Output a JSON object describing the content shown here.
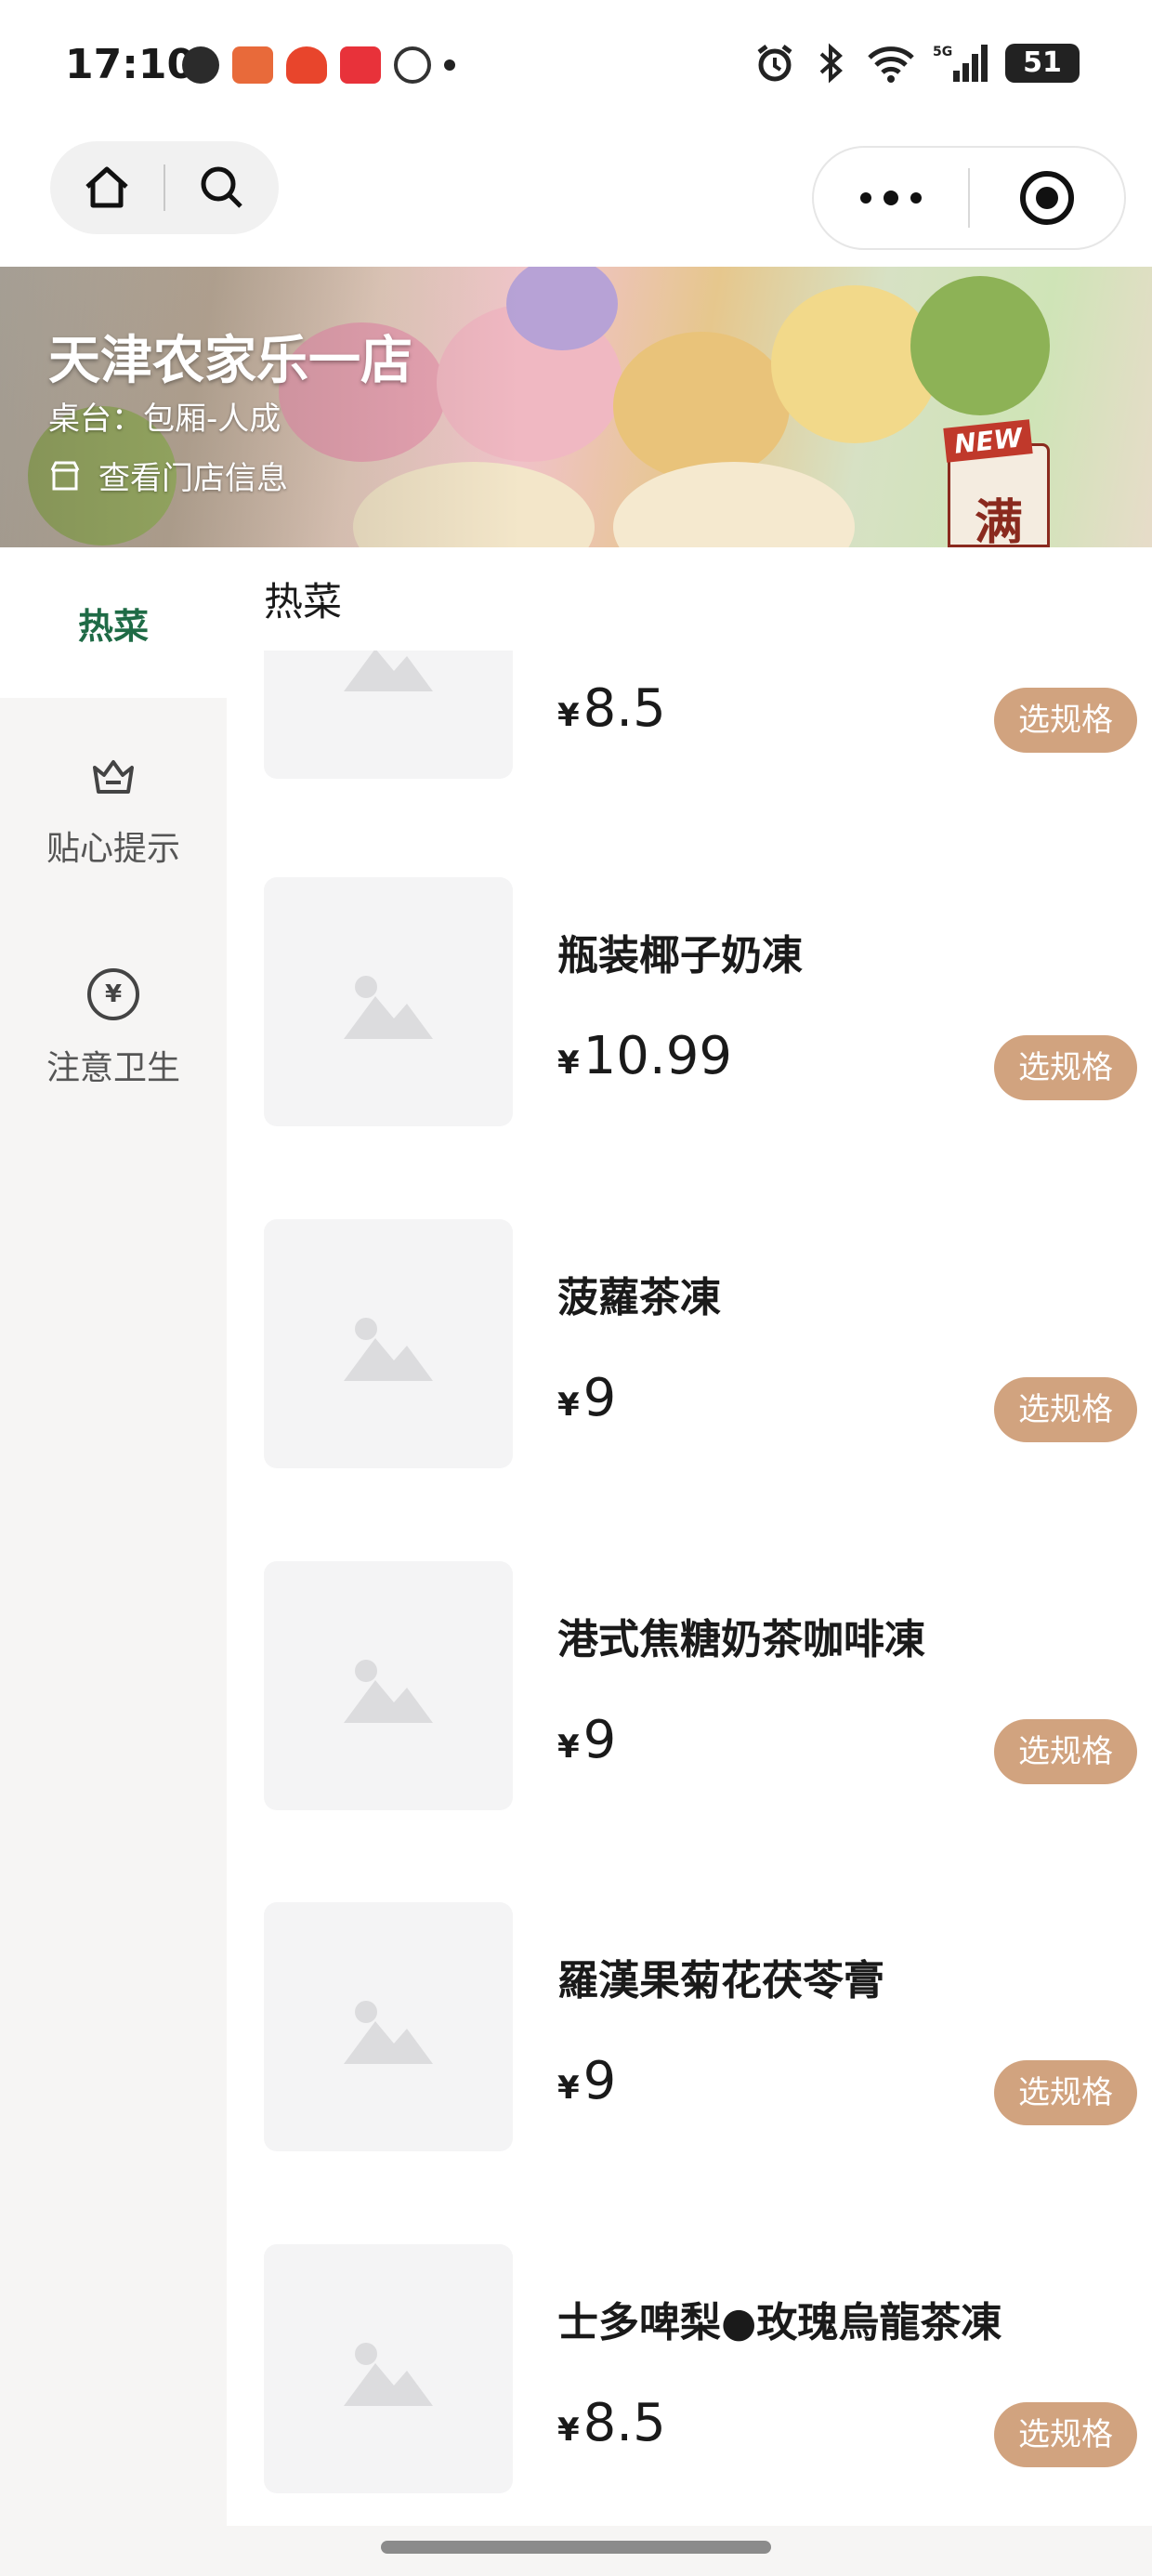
{
  "status_bar": {
    "time": "17:10",
    "battery": "51",
    "network": "5G",
    "icons": [
      "wechat-icon",
      "game-icon",
      "taobao-icon",
      "toutiao-icon",
      "chat-icon",
      "alarm-icon",
      "bluetooth-icon",
      "wifi-icon",
      "signal-icon",
      "battery-icon"
    ]
  },
  "nav": {
    "home_icon": "home-icon",
    "search_icon": "search-icon",
    "more_icon": "more-dots-icon",
    "close_icon": "target-close-icon"
  },
  "banner": {
    "store_name": "天津农家乐一店",
    "table_info": "桌台：包厢-人成",
    "store_link": "查看门店信息",
    "new_tag": "NEW",
    "tag_glyph": "满"
  },
  "sidebar": {
    "items": [
      {
        "label": "热菜",
        "active": true
      },
      {
        "label": "贴心提示",
        "icon": "crown-basket-icon"
      },
      {
        "label": "注意卫生",
        "icon": "yuan-coin-icon"
      }
    ]
  },
  "category_title": "热菜",
  "currency": "¥",
  "spec_button": "选规格",
  "products": [
    {
      "name": "",
      "price": "8.5"
    },
    {
      "name": "瓶装椰子奶凍",
      "price": "10.99"
    },
    {
      "name": "菠蘿茶凍",
      "price": "9"
    },
    {
      "name": "港式焦糖奶茶咖啡凍",
      "price": "9"
    },
    {
      "name": "羅漢果菊花茯苓膏",
      "price": "9"
    },
    {
      "name": "士多啤梨●玫瑰烏龍茶凍",
      "price": "8.5"
    }
  ],
  "colors": {
    "accent_green": "#1f6b46",
    "spec_button": "#d1a37f",
    "sidebar_bg": "#f6f5f4"
  }
}
